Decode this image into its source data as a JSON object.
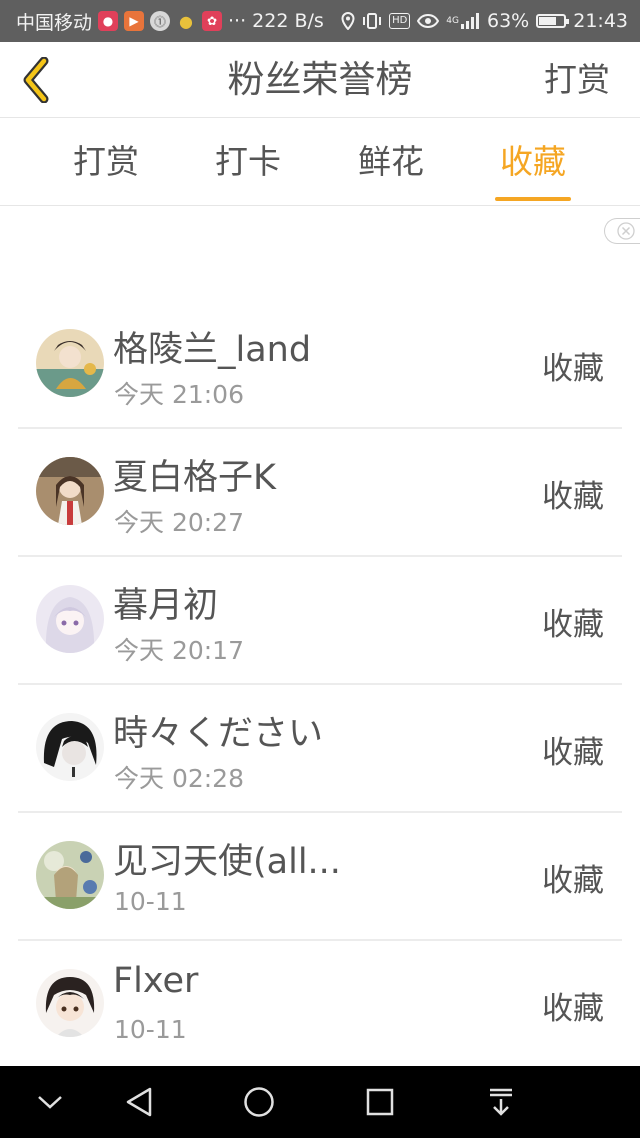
{
  "status_bar": {
    "carrier": "中国移动",
    "network_speed": "222 B/s",
    "ellipsis": "···",
    "hd_badge": "HD",
    "signal_label": "4G",
    "battery_percent": "63%",
    "battery_level": 0.63,
    "time": "21:43"
  },
  "header": {
    "title": "粉丝荣誉榜",
    "action_label": "打赏"
  },
  "tabs": [
    {
      "label": "打赏",
      "active": false
    },
    {
      "label": "打卡",
      "active": false
    },
    {
      "label": "鲜花",
      "active": false
    },
    {
      "label": "收藏",
      "active": true
    }
  ],
  "list": {
    "items": [
      {
        "name": "格陵兰_land",
        "time": "今天 21:06",
        "action": "收藏"
      },
      {
        "name": "夏白格子K",
        "time": "今天 20:27",
        "action": "收藏"
      },
      {
        "name": "暮月初",
        "time": "今天 20:17",
        "action": "收藏"
      },
      {
        "name": "時々ください",
        "time": "今天 02:28",
        "action": "收藏"
      },
      {
        "name": "见习天使(all...",
        "time": "10-11",
        "action": "收藏"
      },
      {
        "name": "Flxer",
        "time": "10-11",
        "action": "收藏"
      }
    ]
  },
  "colors": {
    "accent": "#f5a623",
    "text": "#555555",
    "subtext": "#9a9a9a",
    "status_bar_bg": "#5f5f5f"
  }
}
